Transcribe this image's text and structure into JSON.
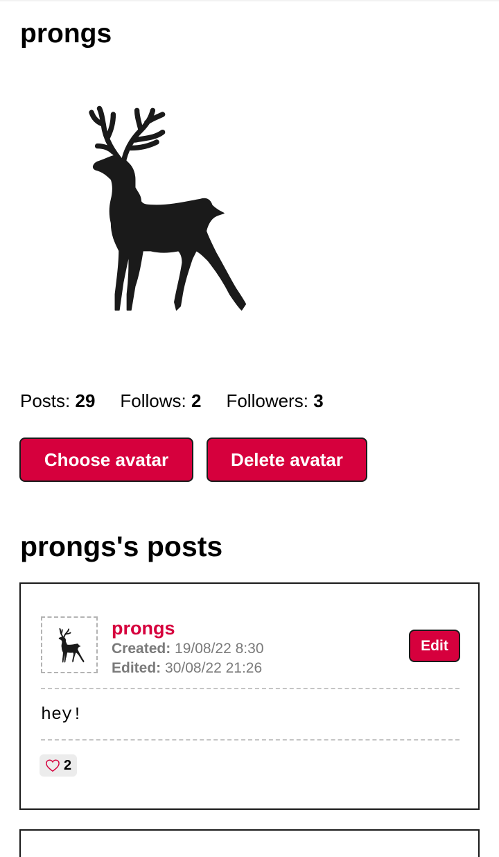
{
  "profile": {
    "username": "prongs",
    "stats": {
      "posts_label": "Posts:",
      "posts_value": "29",
      "follows_label": "Follows:",
      "follows_value": "2",
      "followers_label": "Followers:",
      "followers_value": "3"
    },
    "choose_avatar_label": "Choose avatar",
    "delete_avatar_label": "Delete avatar",
    "avatar_icon": "stag-silhouette"
  },
  "posts_section": {
    "heading": "prongs's posts",
    "posts": [
      {
        "author": "prongs",
        "created_label": "Created:",
        "created_value": "19/08/22 8:30",
        "edited_label": "Edited:",
        "edited_value": "30/08/22 21:26",
        "edit_label": "Edit",
        "body": "hey!",
        "like_icon": "heart-outline-icon",
        "likes": "2"
      }
    ]
  },
  "colors": {
    "accent": "#d6003d",
    "text": "#000000",
    "muted": "#7a7a7a",
    "border": "#1a1a1a"
  }
}
